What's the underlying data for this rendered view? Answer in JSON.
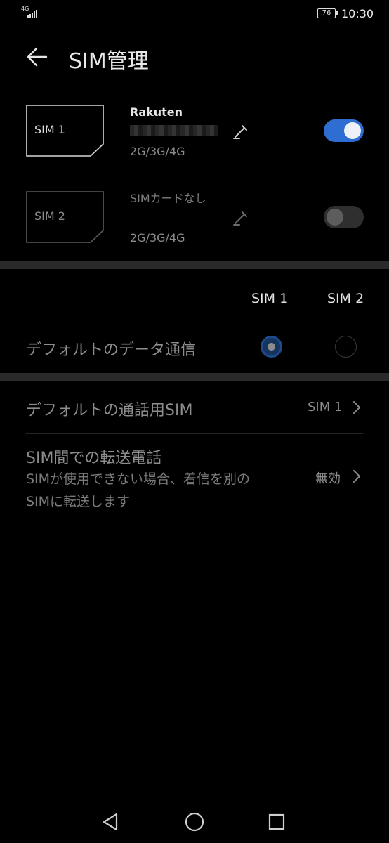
{
  "status_bar": {
    "network": "4G",
    "battery": "76",
    "time": "10:30"
  },
  "header": {
    "title": "SIM管理"
  },
  "sims": [
    {
      "card_label": "SIM 1",
      "name": "Rakuten",
      "network_types": "2G/3G/4G",
      "enabled": true
    },
    {
      "card_label": "SIM 2",
      "name": "SIMカードなし",
      "network_types": "2G/3G/4G",
      "enabled": false
    }
  ],
  "default_data": {
    "col1": "SIM 1",
    "col2": "SIM 2",
    "label": "デフォルトのデータ通信",
    "selected": "SIM 1"
  },
  "default_call": {
    "label": "デフォルトの通話用SIM",
    "value": "SIM 1"
  },
  "forwarding": {
    "title": "SIM間での転送電話",
    "subtitle": "SIMが使用できない場合、着信を別のSIMに転送します",
    "value": "無効"
  },
  "icons": {
    "back": "arrow-left-icon",
    "edit": "pencil-icon",
    "chevron": "chevron-right-icon",
    "nav_back": "triangle-back-icon",
    "nav_home": "circle-home-icon",
    "nav_recents": "square-recents-icon"
  },
  "colors": {
    "background": "#000000",
    "accent": "#2e6ed3"
  }
}
